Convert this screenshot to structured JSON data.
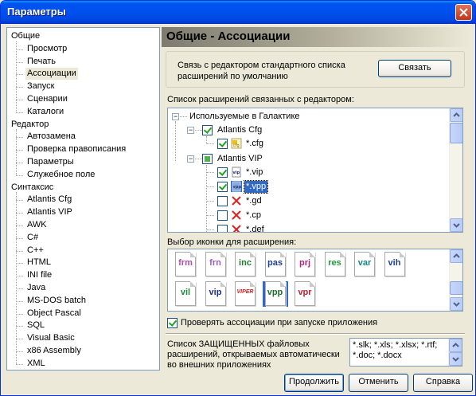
{
  "window": {
    "title": "Параметры"
  },
  "tree": {
    "groups": [
      {
        "label": "Общие",
        "children": [
          "Просмотр",
          "Печать",
          "Ассоциации",
          "Запуск",
          "Сценарии",
          "Каталоги"
        ]
      },
      {
        "label": "Редактор",
        "children": [
          "Автозамена",
          "Проверка правописания",
          "Параметры",
          "Служебное поле"
        ]
      },
      {
        "label": "Синтаксис",
        "children": [
          "Atlantis Cfg",
          "Atlantis VIP",
          "AWK",
          "C#",
          "C++",
          "HTML",
          "INI file",
          "Java",
          "MS-DOS batch",
          "Object Pascal",
          "SQL",
          "Visual Basic",
          "x86 Assembly",
          "XML"
        ]
      }
    ],
    "selected": "Ассоциации"
  },
  "header": {
    "title": "Общие - Ассоциации"
  },
  "link_group": {
    "text": "Связь с редактором стандартного списка расширений по умолчанию",
    "button": "Связать"
  },
  "ext_list": {
    "label": "Список расширений связанных с редактором:",
    "root": "Используемые в Галактике",
    "nodes": [
      {
        "label": "Atlantis Cfg",
        "checked": "yes",
        "children": [
          {
            "label": "*.cfg",
            "checked": "yes",
            "icon": "cfg-file-icon"
          }
        ]
      },
      {
        "label": "Atlantis VIP",
        "checked": "partial",
        "children": [
          {
            "label": "*.vip",
            "checked": "yes",
            "icon": "vip-file-icon"
          },
          {
            "label": "*.vpp",
            "checked": "yes",
            "icon": "vpp-file-icon",
            "selected": true
          },
          {
            "label": "*.gd",
            "checked": "no",
            "icon": "red-x-icon"
          },
          {
            "label": "*.cp",
            "checked": "no",
            "icon": "red-x-icon"
          },
          {
            "label": "*.def",
            "checked": "no",
            "icon": "red-x-icon"
          }
        ]
      }
    ]
  },
  "icon_picker": {
    "label": "Выбор иконки для расширения:",
    "icons": [
      {
        "code": "frm",
        "color": "#B04DB0"
      },
      {
        "code": "frn",
        "color": "#9A5CB8"
      },
      {
        "code": "inc",
        "color": "#1D7A2A"
      },
      {
        "code": "pas",
        "color": "#1E3E9E"
      },
      {
        "code": "prj",
        "color": "#B0267A"
      },
      {
        "code": "res",
        "color": "#1F9A3A"
      },
      {
        "code": "var",
        "color": "#17888A"
      },
      {
        "code": "vih",
        "color": "#1E3E9E"
      },
      {
        "code": "vil",
        "color": "#1E8A3A"
      },
      {
        "code": "vip",
        "color": "#1E2E8E"
      },
      {
        "code": "VIPER",
        "color": "#D02020"
      },
      {
        "code": "vpp",
        "color": "#1E6E2E",
        "selected": true
      },
      {
        "code": "vpr",
        "color": "#C02030"
      }
    ]
  },
  "check_assoc": {
    "label": "Проверять ассоциации при запуске приложения",
    "checked": true
  },
  "protected": {
    "label": "Список ЗАЩИЩЕННЫХ файловых расширений, открываемых автоматически во внешних приложениях",
    "value": "*.slk; *.xls; *.xlsx; *.rtf; *.doc; *.docx"
  },
  "footer": {
    "ok": "Продолжить",
    "cancel": "Отменить",
    "help": "Справка"
  }
}
